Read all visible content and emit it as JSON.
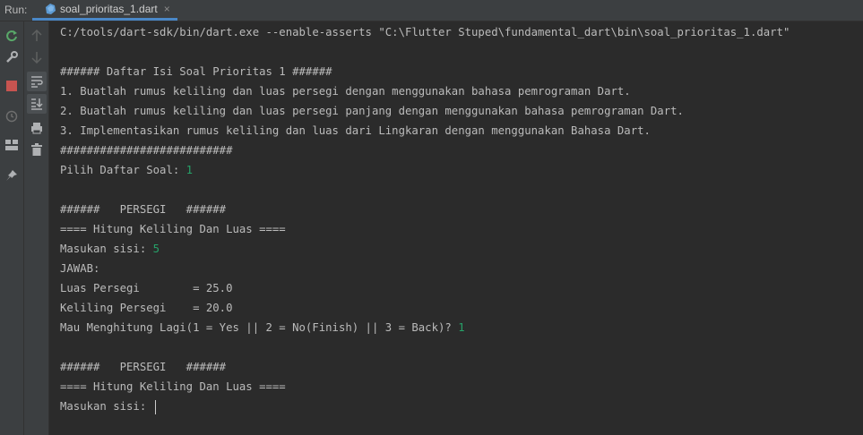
{
  "run_panel": {
    "label": "Run:",
    "tab": {
      "label": "soal_prioritas_1.dart",
      "close": "×"
    }
  },
  "toolbar": {
    "icons": [
      "rerun-icon",
      "settings-wrench-icon",
      "stop-icon",
      "clock-icon",
      "layout-icon",
      "pin-icon"
    ],
    "icons2": [
      "up-arrow-icon",
      "down-arrow-icon",
      "soft-wrap-icon",
      "scroll-to-end-icon",
      "print-icon",
      "trash-icon"
    ]
  },
  "console": {
    "command": "C:/tools/dart-sdk/bin/dart.exe --enable-asserts \"C:\\Flutter Stuped\\fundamental_dart\\bin\\soal_prioritas_1.dart\"",
    "menu_header": "###### Daftar Isi Soal Prioritas 1 ######",
    "item1": "1. Buatlah rumus keliling dan luas persegi dengan menggunakan bahasa pemrograman Dart.",
    "item2": "2. Buatlah rumus keliling dan luas persegi panjang dengan menggunakan bahasa pemrograman Dart.",
    "item3": "3. Implementasikan rumus keliling dan luas dari Lingkaran dengan menggunakan Bahasa Dart.",
    "separator": "##########################",
    "choose_prompt": "Pilih Daftar Soal: ",
    "choose_input": "1",
    "persegi_header": "######   PERSEGI   ######",
    "hitung_header": "==== Hitung Keliling Dan Luas ====",
    "sisi_prompt": "Masukan sisi: ",
    "sisi_input": "5",
    "jawab": "JAWAB:",
    "luas": "Luas Persegi        = 25.0",
    "keliling": "Keliling Persegi    = 20.0",
    "again_prompt": "Mau Menghitung Lagi(1 = Yes || 2 = No(Finish) || 3 = Back)? ",
    "again_input": "1",
    "persegi_header2": "######   PERSEGI   ######",
    "hitung_header2": "==== Hitung Keliling Dan Luas ====",
    "sisi_prompt2": "Masukan sisi: "
  }
}
